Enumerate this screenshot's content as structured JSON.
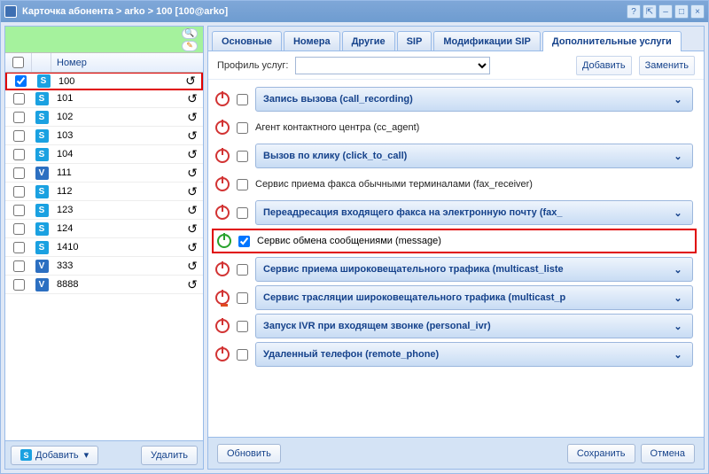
{
  "title": "Карточка абонента > arko > 100 [100@arko]",
  "left": {
    "header_number": "Номер",
    "rows": [
      {
        "num": "100",
        "type": "S",
        "checked": true,
        "selected": true
      },
      {
        "num": "101",
        "type": "S",
        "checked": false
      },
      {
        "num": "102",
        "type": "S",
        "checked": false
      },
      {
        "num": "103",
        "type": "S",
        "checked": false
      },
      {
        "num": "104",
        "type": "S",
        "checked": false
      },
      {
        "num": "111",
        "type": "V",
        "checked": false
      },
      {
        "num": "112",
        "type": "S",
        "checked": false
      },
      {
        "num": "123",
        "type": "S",
        "checked": false
      },
      {
        "num": "124",
        "type": "S",
        "checked": false
      },
      {
        "num": "1410",
        "type": "S",
        "checked": false
      },
      {
        "num": "333",
        "type": "V",
        "checked": false
      },
      {
        "num": "8888",
        "type": "V",
        "checked": false
      }
    ],
    "add_btn": "Добавить",
    "del_btn": "Удалить"
  },
  "tabs": {
    "items": [
      "Основные",
      "Номера",
      "Другие",
      "SIP",
      "Модификации SIP",
      "Дополнительные услуги"
    ],
    "active": 5
  },
  "profile": {
    "label": "Профиль услуг:",
    "add": "Добавить",
    "replace": "Заменить"
  },
  "services": [
    {
      "kind": "box",
      "label": "Запись вызова (call_recording)",
      "power": "off",
      "chk": false
    },
    {
      "kind": "plain",
      "label": "Агент контактного центра (cc_agent)",
      "power": "off",
      "chk": false
    },
    {
      "kind": "box",
      "label": "Вызов по клику (click_to_call)",
      "power": "off",
      "chk": false
    },
    {
      "kind": "plain",
      "label": "Сервис приема факса обычными терминалами (fax_receiver)",
      "power": "off",
      "chk": false
    },
    {
      "kind": "box",
      "label": "Переадресация входящего факса на электронную почту (fax_",
      "power": "off",
      "chk": false
    },
    {
      "kind": "plain",
      "label": "Сервис обмена сообщениями (message)",
      "power": "on",
      "chk": true,
      "selected": true
    },
    {
      "kind": "box",
      "label": "Сервис приема широковещательного трафика (multicast_liste",
      "power": "off",
      "chk": false
    },
    {
      "kind": "box",
      "label": "Сервис трасляции широковещательного трафика (multicast_p",
      "power": "warn",
      "chk": false
    },
    {
      "kind": "box",
      "label": "Запуск IVR при входящем звонке (personal_ivr)",
      "power": "off",
      "chk": false
    },
    {
      "kind": "box",
      "label": "Удаленный телефон (remote_phone)",
      "power": "off",
      "chk": false
    }
  ],
  "buttons": {
    "refresh": "Обновить",
    "save": "Сохранить",
    "cancel": "Отмена"
  }
}
